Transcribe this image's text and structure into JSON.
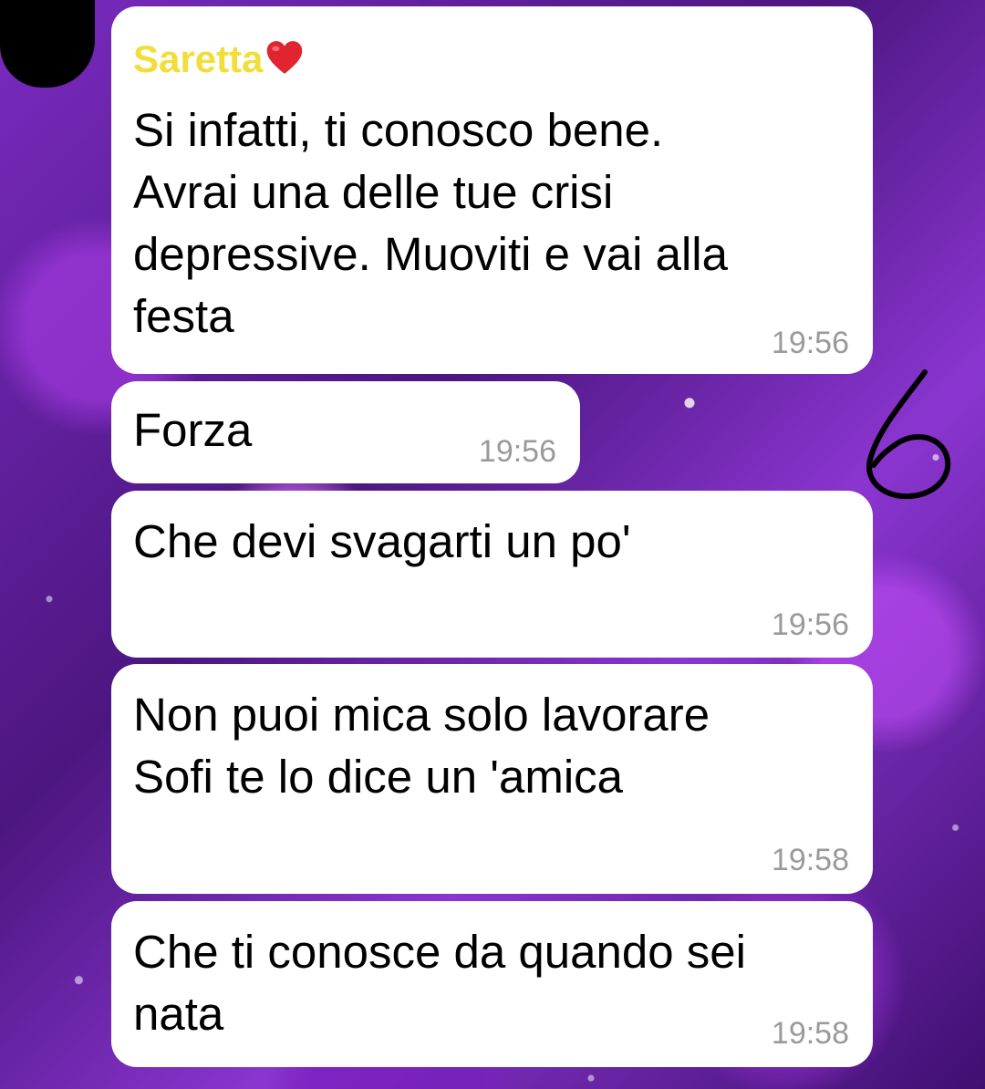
{
  "chat": {
    "sender_name": "Saretta",
    "sender_emoji": "❤️",
    "messages": [
      {
        "lines": [
          "Si infatti, ti conosco bene.",
          "Avrai una delle tue crisi",
          "depressive. Muoviti e vai alla",
          "festa"
        ],
        "time": "19:56"
      },
      {
        "lines": [
          "Forza"
        ],
        "time": "19:56"
      },
      {
        "lines": [
          "Che devi svagarti un po'"
        ],
        "time": "19:56"
      },
      {
        "lines": [
          "Non puoi mica solo lavorare",
          "Sofi te lo dice un 'amica"
        ],
        "time": "19:58"
      },
      {
        "lines": [
          "Che ti conosce da quando sei",
          "nata"
        ],
        "time": "19:58"
      }
    ]
  },
  "annotation": {
    "handwritten_number": "6"
  }
}
